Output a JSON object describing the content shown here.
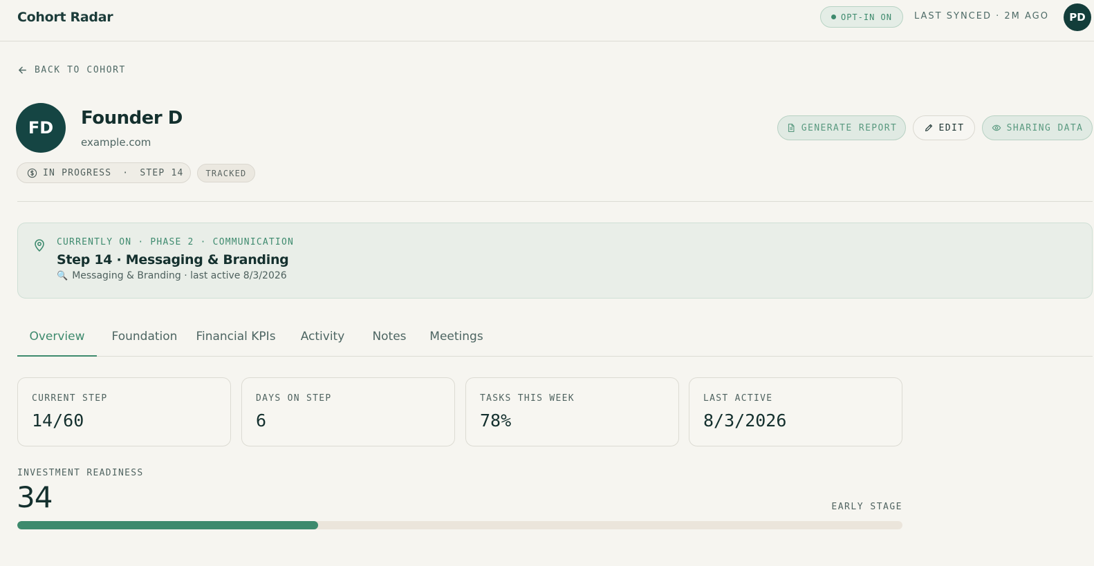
{
  "app": {
    "title": "Cohort Radar",
    "opt_in": "OPT-IN ON",
    "last_synced": "LAST SYNCED · 2M AGO",
    "user_initials": "PD"
  },
  "nav": {
    "back_label": "BACK TO COHORT"
  },
  "founder": {
    "initials": "FD",
    "name": "Founder D",
    "website": "example.com",
    "status": "IN PROGRESS",
    "status_separator": "·",
    "step": "STEP 14",
    "tracked": "TRACKED"
  },
  "actions": {
    "generate_report": "GENERATE REPORT",
    "edit": "EDIT",
    "sharing_data": "SHARING DATA"
  },
  "current": {
    "kicker": "CURRENTLY ON · PHASE 2 · COMMUNICATION",
    "title": "Step 14 · Messaging & Branding",
    "subtitle_icon": "🔍",
    "subtitle": "Messaging & Branding · last active 8/3/2026"
  },
  "tabs": [
    {
      "label": "Overview",
      "active": true
    },
    {
      "label": "Foundation"
    },
    {
      "label": "Financial KPIs"
    },
    {
      "label": "Activity"
    },
    {
      "label": "Notes"
    },
    {
      "label": "Meetings"
    }
  ],
  "stats": [
    {
      "label": "CURRENT STEP",
      "value": "14/60"
    },
    {
      "label": "DAYS ON STEP",
      "value": "6"
    },
    {
      "label": "TASKS THIS WEEK",
      "value": "78%"
    },
    {
      "label": "LAST ACTIVE",
      "value": "8/3/2026"
    }
  ],
  "readiness": {
    "label": "INVESTMENT READINESS",
    "score": "34",
    "stage": "EARLY STAGE",
    "fraction": 0.34
  },
  "colors": {
    "accent": "#3d8a6d",
    "dark": "#133d3a",
    "background": "#f6f5f0"
  }
}
